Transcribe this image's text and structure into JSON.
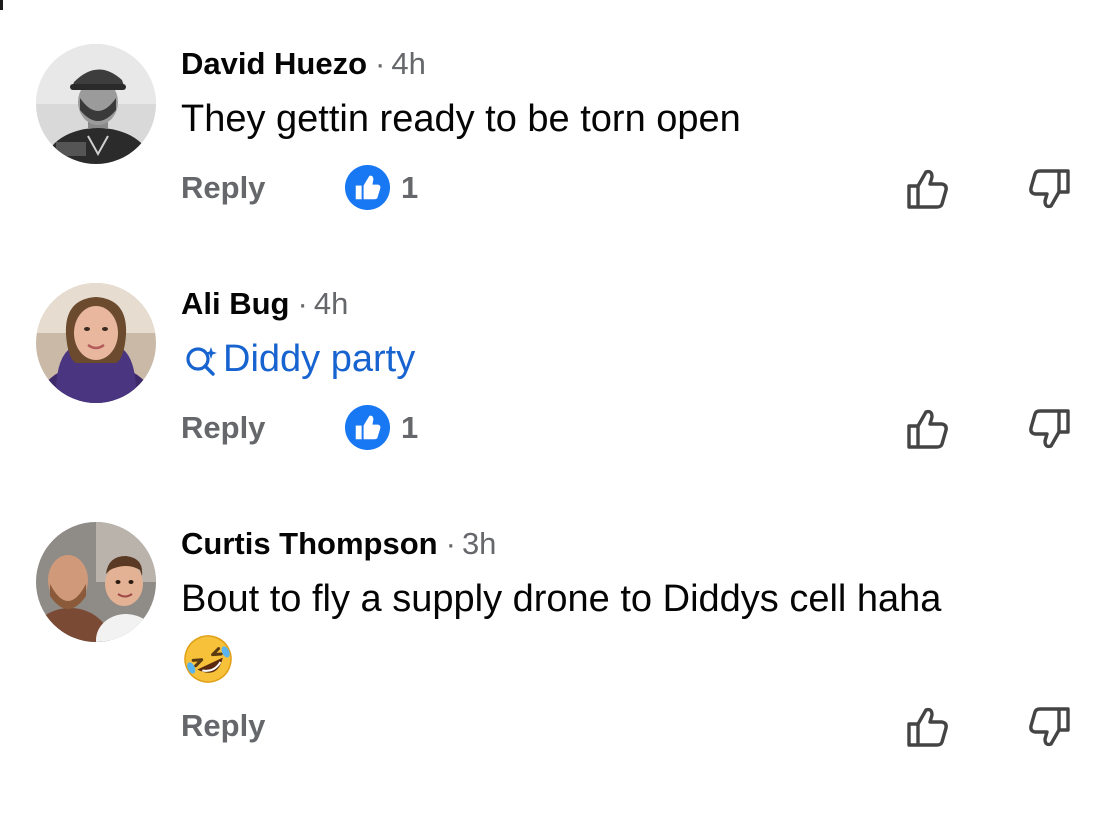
{
  "comments": [
    {
      "author": "David Huezo",
      "separator": "·",
      "time": "4h",
      "text": "They gettin ready to be torn open",
      "text_type": "plain",
      "reply_label": "Reply",
      "like_count": "1"
    },
    {
      "author": "Ali Bug",
      "separator": "·",
      "time": "4h",
      "text": "Diddy party",
      "text_type": "search-link",
      "reply_label": "Reply",
      "like_count": "1"
    },
    {
      "author": "Curtis Thompson",
      "separator": "·",
      "time": "3h",
      "text": "Bout to fly a supply drone to Diddys cell haha",
      "text_type": "plain",
      "emoji": "rolling-on-floor-laughing",
      "reply_label": "Reply"
    }
  ],
  "icons": {
    "like_badge": "like-badge-icon",
    "upvote": "thumbs-up-outline-icon",
    "downvote": "thumbs-down-outline-icon",
    "search_spark": "search-sparkle-icon"
  },
  "colors": {
    "link_blue": "#1763cf",
    "like_blue": "#1877f2",
    "meta_gray": "#65676b",
    "text": "#050505"
  }
}
